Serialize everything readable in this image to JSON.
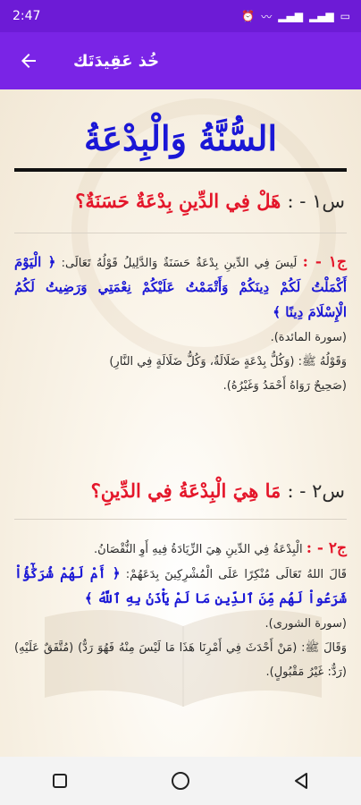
{
  "status": {
    "time": "2:47",
    "battery_icon": "battery-icon",
    "signal_icon": "signal-icon"
  },
  "appbar": {
    "title": "خُذ عَقِيدَتَك",
    "back_icon": "back-arrow-icon"
  },
  "content": {
    "main_title": "السُّنَّةُ وَالْبِدْعَةُ",
    "questions": [
      {
        "num": "س١ - :",
        "text": "هَلْ فِي الدِّينِ بِدْعَةٌ حَسَنَةٌ؟",
        "answer_label": "ج١ - :",
        "answer_intro": "لَيسَ فِي الدِّينِ بِدْعَةٌ حَسَنَةٌ وَالدَّلِيلُ قَوْلُهُ تَعَالَى:",
        "ayah": "﴿ الْيَوْمَ أَكْمَلْتُ لَكُمْ دِينَكُمْ وَأَتْمَمْتُ عَلَيْكُمْ نِعْمَتِي وَرَضِيتُ لَكُمُ الْإِسْلَامَ دِينًا ﴾",
        "ayah_ref": "(سورة المائدة).",
        "hadith": "وَقَوْلُهُ ﷺ: (وَكُلُّ بِدْعَةٍ ضَلَالَةٌ، وَكُلُّ ضَلَالَةٍ فِي النَّارِ)",
        "hadith_ref": "(صَحِيحٌ رَوَاهُ أَحْمَدُ وَغَيْرُهُ)."
      },
      {
        "num": "س٢ - :",
        "text": "مَا هِيَ الْبِدْعَةُ فِي الدِّينِ؟",
        "answer_label": "ج٢ - :",
        "answer_intro": "الْبِدْعَةُ فِي الدِّينِ هِيَ الزِّيَادَةُ فِيهِ أَوِ النُّقْصَانُ.",
        "line2": "قَالَ اللهُ تَعَالَى مُنْكِرًا عَلَى الْمُشْرِكِينَ بِدَعَهُمْ:",
        "ayah": "﴿ أَمْ لَهُمْ شُرَكَٰٓؤُاْ شَرَعُواْ لَهُم مِّنَ ٱلدِّينِ مَا لَمْ يَأْذَنۢ بِهِ ٱللَّهُ ﴾",
        "ayah_ref": "(سورة الشورى).",
        "hadith": "وَقَالَ ﷺ: (مَنْ أَحْدَثَ فِي أَمْرِنَا هَذَا مَا لَيْسَ مِنْهُ فَهُوَ رَدٌّ)",
        "hadith_ref": "(مُتَّفَقٌ عَلَيْهِ) (رَدٌّ: غَيْرُ مَقْبُولٍ)."
      }
    ]
  },
  "nav": {
    "recent": "square-icon",
    "home": "circle-icon",
    "back": "triangle-back-icon"
  }
}
